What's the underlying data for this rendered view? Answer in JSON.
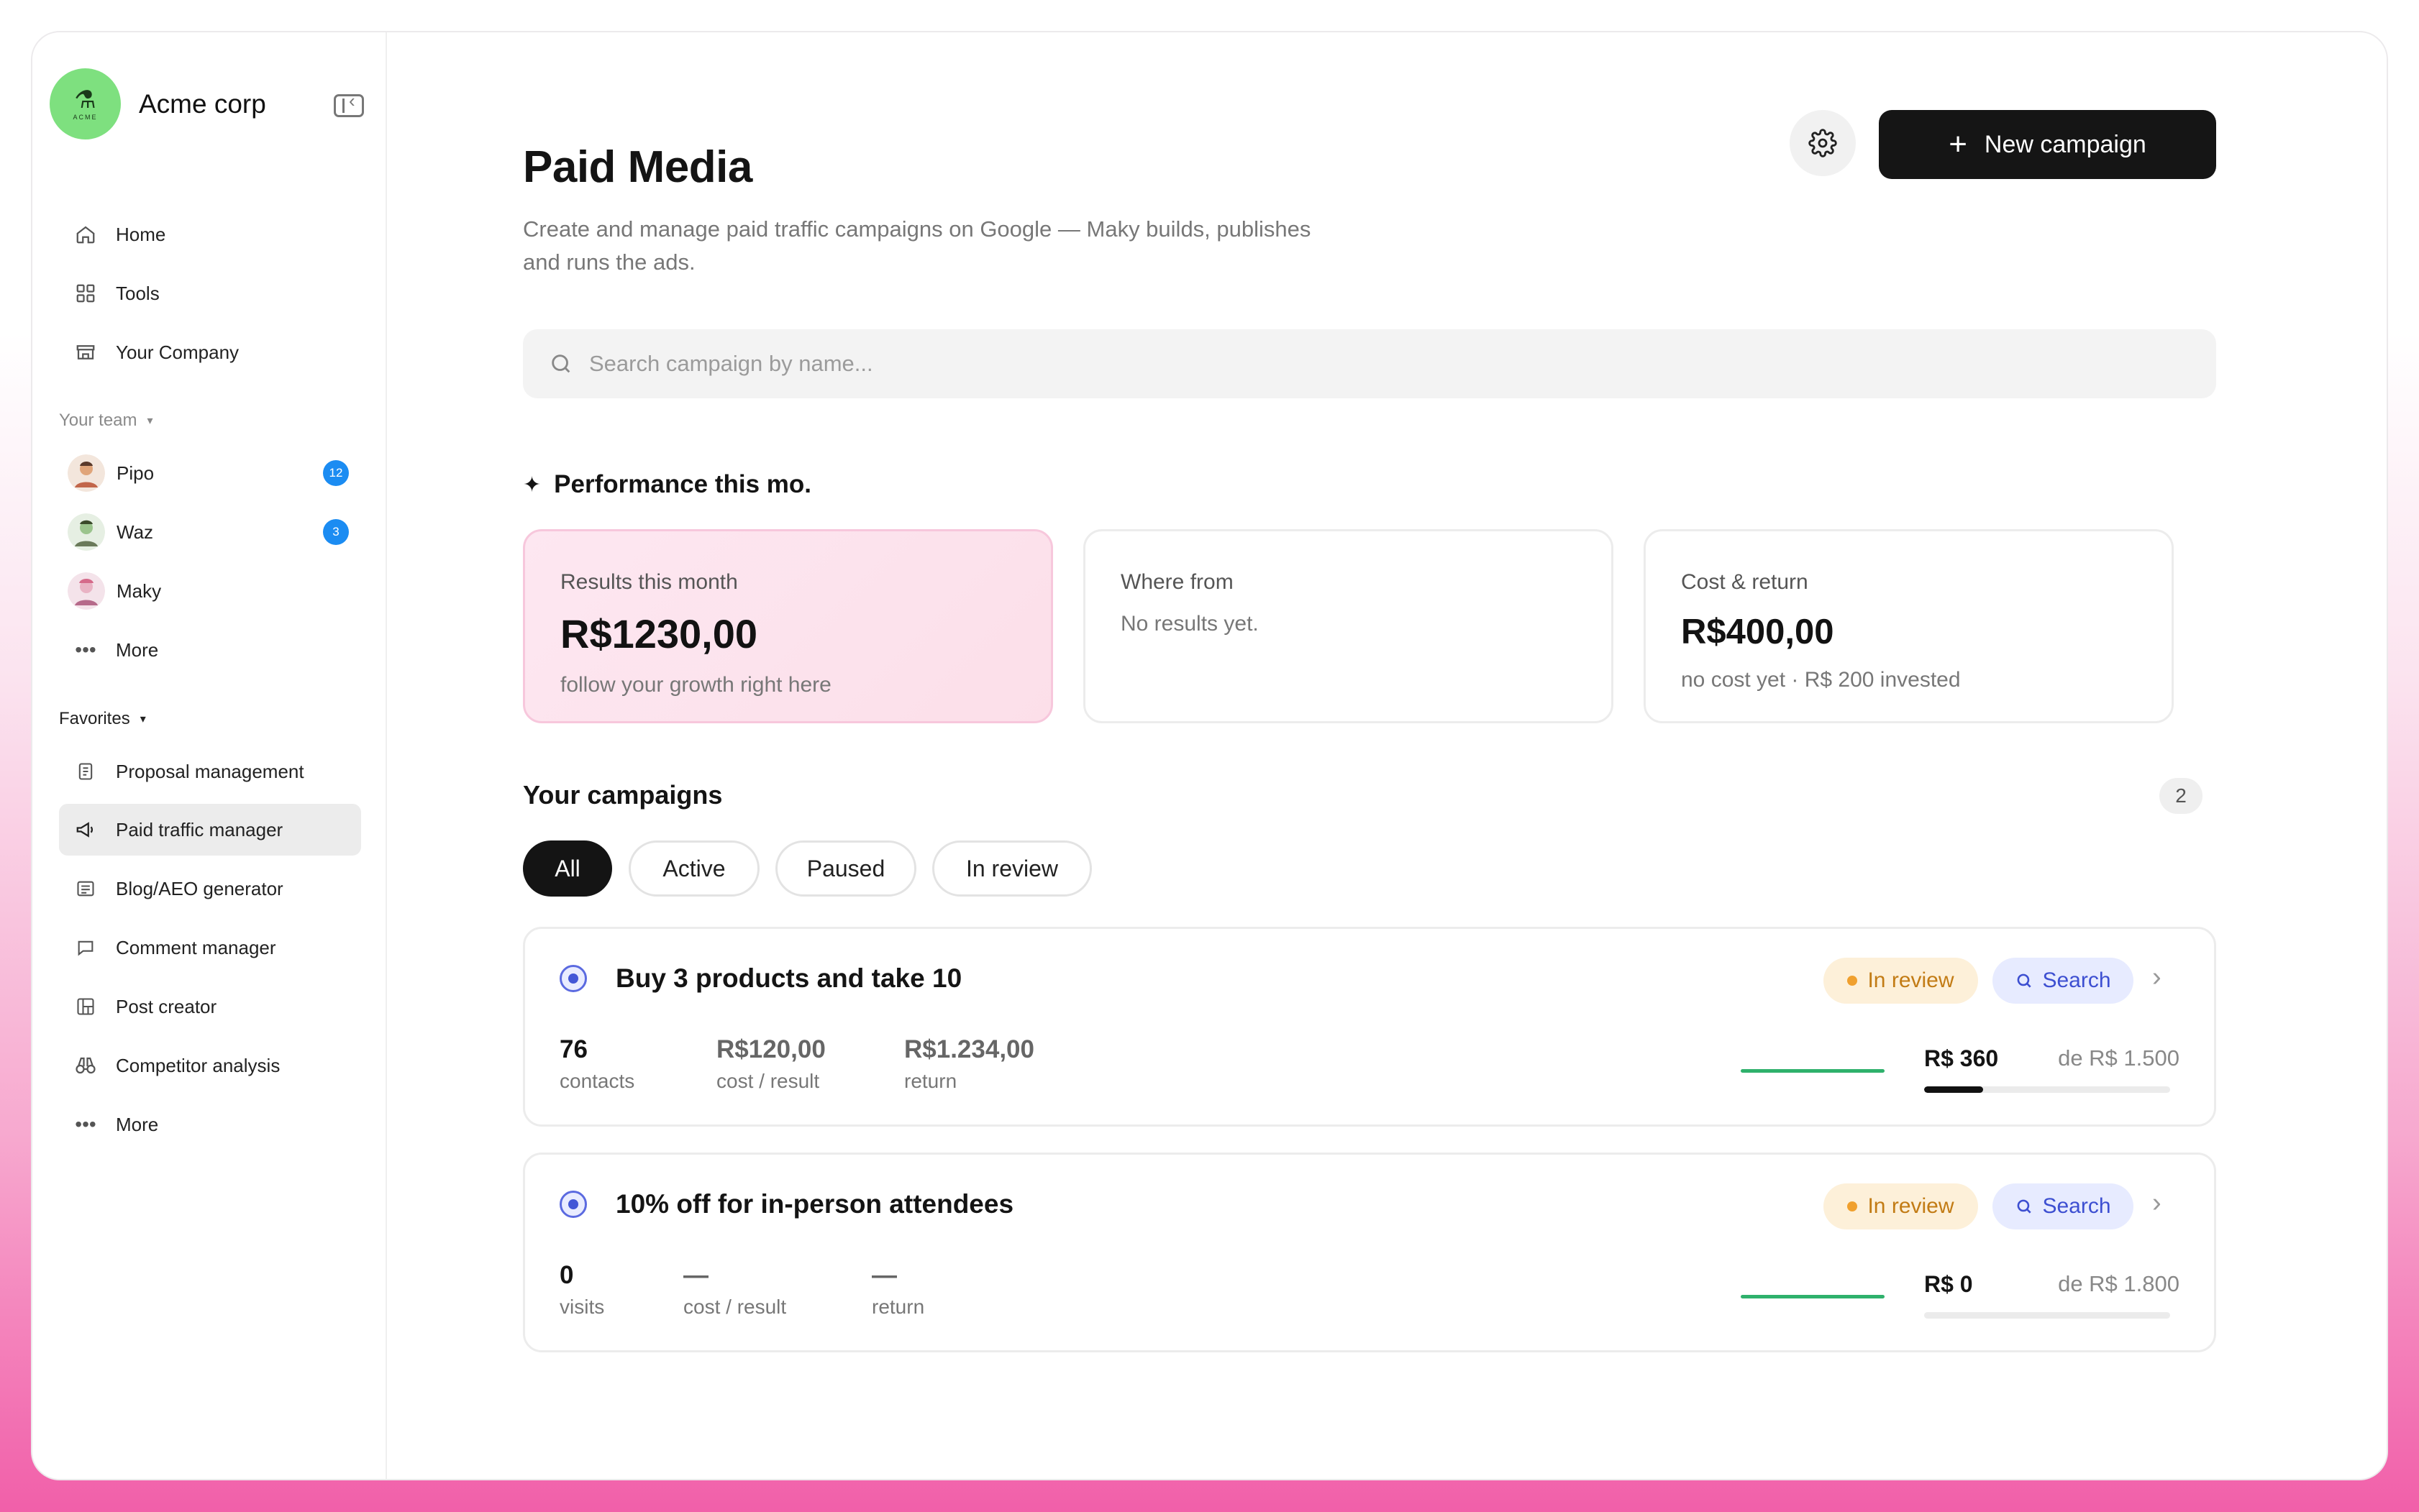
{
  "org": {
    "name": "Acme corp",
    "logo_text": "ACME"
  },
  "sidebar": {
    "nav": [
      {
        "label": "Home",
        "icon": "home-icon"
      },
      {
        "label": "Tools",
        "icon": "grid-icon"
      },
      {
        "label": "Your Company",
        "icon": "store-icon"
      }
    ],
    "team_label": "Your team",
    "team": [
      {
        "label": "Pipo",
        "badge": "12"
      },
      {
        "label": "Waz",
        "badge": "3"
      },
      {
        "label": "Maky",
        "badge": ""
      }
    ],
    "team_more": "More",
    "favorites_label": "Favorites",
    "favorites": [
      {
        "label": "Proposal management",
        "icon": "document-icon"
      },
      {
        "label": "Paid traffic manager",
        "icon": "megaphone-icon",
        "active": true
      },
      {
        "label": "Blog/AEO generator",
        "icon": "article-icon"
      },
      {
        "label": "Comment manager",
        "icon": "comment-icon"
      },
      {
        "label": "Post creator",
        "icon": "layout-icon"
      },
      {
        "label": "Competitor analysis",
        "icon": "binoculars-icon"
      }
    ],
    "favorites_more": "More"
  },
  "header": {
    "title": "Paid Media",
    "subtitle": "Create and manage paid traffic campaigns on Google — Maky builds, publishes and runs the ads.",
    "new_button": "New campaign"
  },
  "search": {
    "placeholder": "Search campaign by name..."
  },
  "performance": {
    "title": "Performance this mo.",
    "cards": [
      {
        "label": "Results this month",
        "value": "R$1230,00",
        "note": "follow your growth right here"
      },
      {
        "label": "Where from",
        "value": "",
        "note": "No results yet."
      },
      {
        "label": "Cost & return",
        "value": "R$400,00",
        "note": "no cost yet · R$ 200 invested"
      }
    ]
  },
  "campaigns": {
    "title": "Your campaigns",
    "count": "2",
    "filters": [
      "All",
      "Active",
      "Paused",
      "In review"
    ],
    "active_filter": "All",
    "items": [
      {
        "name": "Buy 3 products and take 10",
        "status": "In review",
        "channel": "Search",
        "metrics": [
          {
            "value": "76",
            "label": "contacts"
          },
          {
            "value": "R$120,00",
            "label": "cost / result"
          },
          {
            "value": "R$1.234,00",
            "label": "return"
          }
        ],
        "spent": "R$ 360",
        "budget": "de R$ 1.500",
        "progress": 0.24
      },
      {
        "name": "10% off for in-person attendees",
        "status": "In review",
        "channel": "Search",
        "metrics": [
          {
            "value": "0",
            "label": "visits"
          },
          {
            "value": "—",
            "label": "cost / result"
          },
          {
            "value": "—",
            "label": "return"
          }
        ],
        "spent": "R$ 0",
        "budget": "de R$ 1.800",
        "progress": 0
      }
    ]
  },
  "colors": {
    "accent_dark": "#151515",
    "status_review": "#f0a02e",
    "channel_search": "#3d4fd1",
    "badge_blue": "#1b8cf2",
    "logo_green": "#7ee07f"
  }
}
